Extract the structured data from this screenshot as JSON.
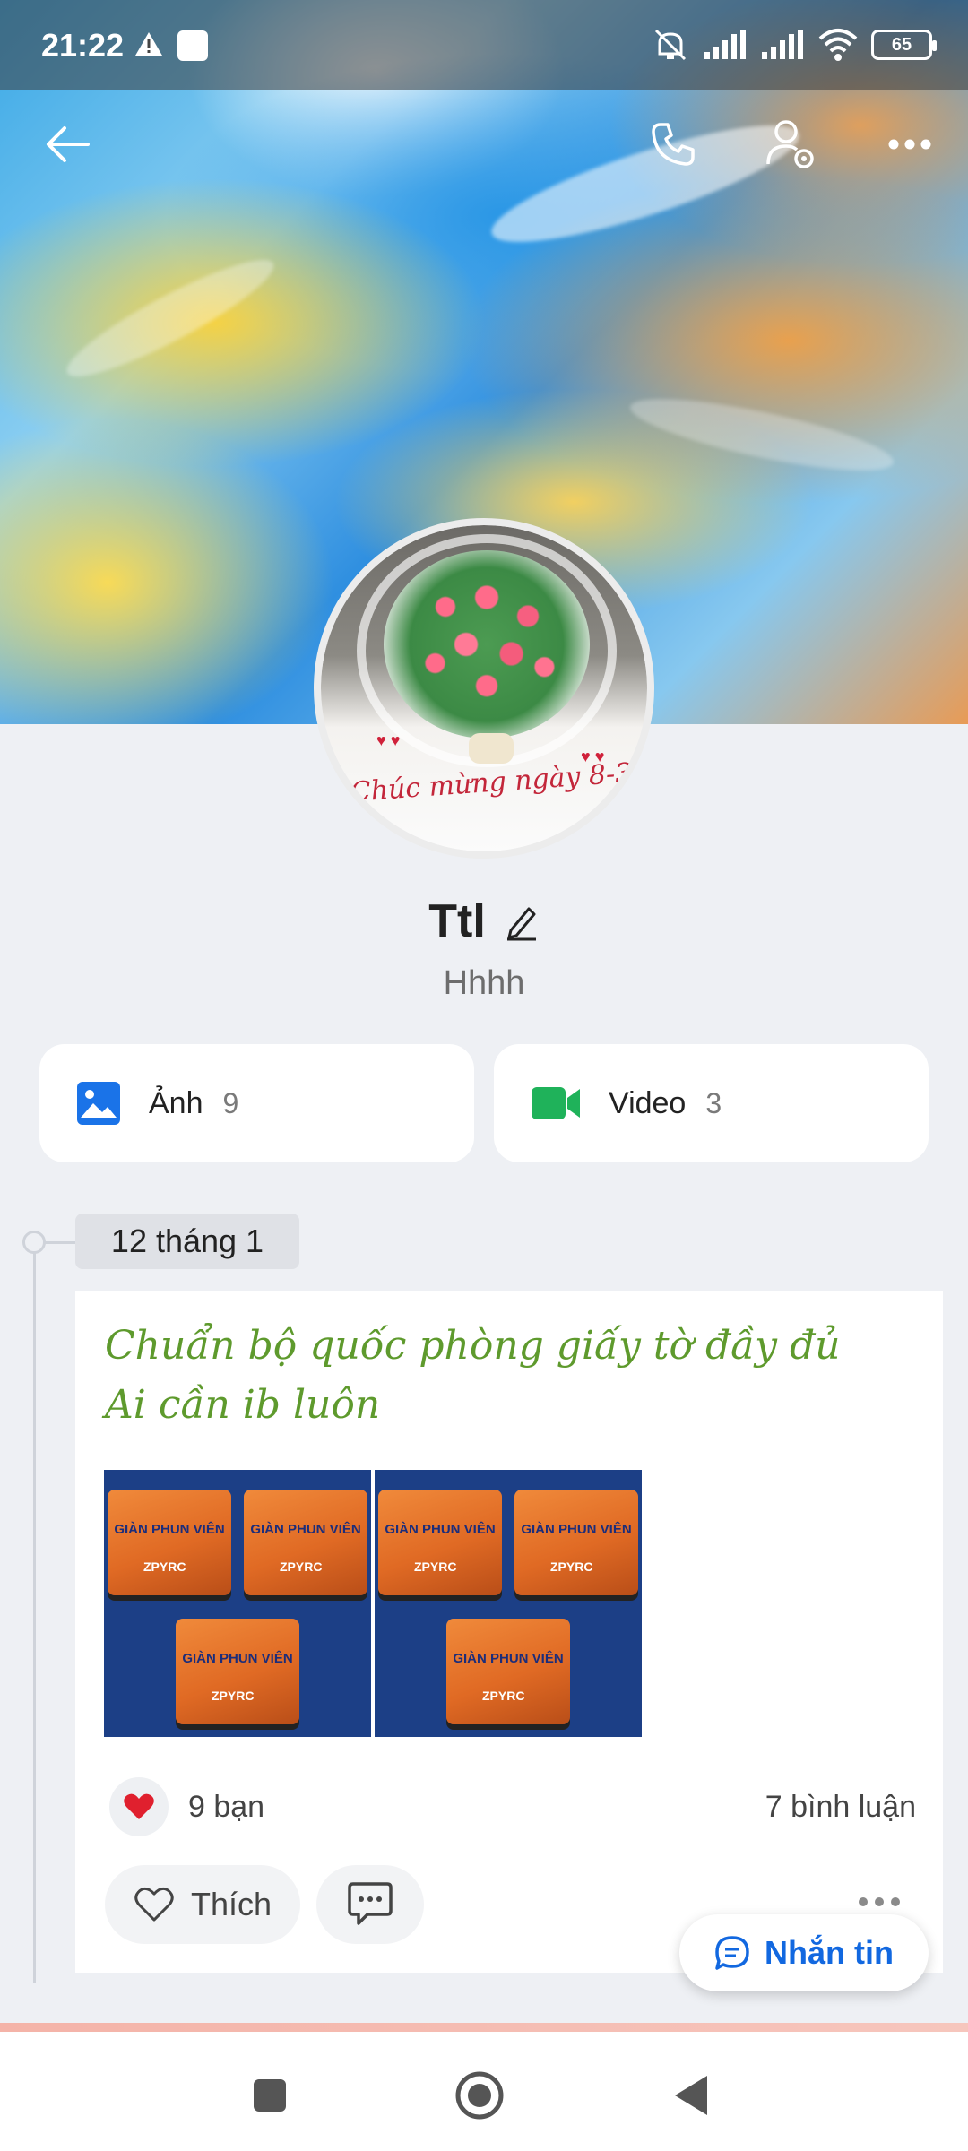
{
  "status_bar": {
    "time": "21:22",
    "battery": "65"
  },
  "profile": {
    "name": "Ttl",
    "bio": "Hhhh"
  },
  "avatar": {
    "caption": "Chúc mừng ngày 8-3"
  },
  "media": {
    "photos": {
      "label": "Ảnh",
      "count": "9"
    },
    "videos": {
      "label": "Video",
      "count": "3"
    }
  },
  "timeline": {
    "date": "12 tháng 1"
  },
  "post": {
    "line1": "Chuẩn bộ quốc phòng giấy tờ đầy đủ",
    "line2": "Ai cần ib luôn",
    "product_line1": "GIÀN PHUN VIÊN",
    "product_line2": "ZPYRC",
    "reaction_count": "9 bạn",
    "comment_count": "7 bình luận",
    "like_label": "Thích"
  },
  "fab": {
    "label": "Nhắn tin"
  },
  "colors": {
    "accent": "#1268e0",
    "post_text": "#5e9a2d",
    "like_heart": "#e0202e",
    "photo_icon": "#1a73e8",
    "video_icon": "#1fb25a"
  },
  "icons": [
    "back-arrow-icon",
    "phone-icon",
    "profile-settings-icon",
    "more-icon",
    "edit-pencil-icon",
    "image-icon",
    "video-camera-icon",
    "heart-icon",
    "comment-icon",
    "chat-bubble-icon"
  ]
}
